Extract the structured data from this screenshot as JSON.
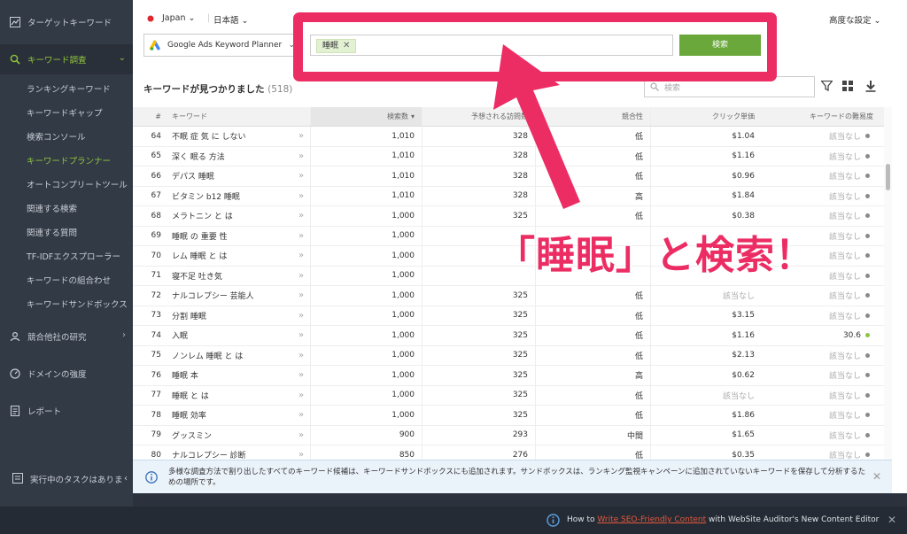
{
  "sidebar": {
    "sections": [
      {
        "label": "ターゲットキーワード",
        "icon": "chart-line-icon"
      },
      {
        "label": "キーワード調査",
        "icon": "search-icon"
      },
      {
        "label": "競合他社の研究",
        "icon": "users-icon"
      },
      {
        "label": "ドメインの強度",
        "icon": "gauge-icon"
      },
      {
        "label": "レポート",
        "icon": "report-icon"
      }
    ],
    "items": [
      "ランキングキーワード",
      "キーワードギャップ",
      "検索コンソール",
      "キーワードプランナー",
      "オートコンプリートツール",
      "関連する検索",
      "関連する質問",
      "TF-IDFエクスプローラー",
      "キーワードの組合わせ",
      "キーワードサンドボックス"
    ],
    "task_label": "実行中のタスクはありま",
    "collapse_glyph": "‹"
  },
  "topbar": {
    "country": "Japan",
    "language": "日本語",
    "advanced": "高度な設定"
  },
  "search": {
    "source": "Google Ads Keyword Planner",
    "tag": "睡眠",
    "button": "検索"
  },
  "results": {
    "title": "キーワードが見つかりました",
    "count": "(518)",
    "filter_placeholder": "検索"
  },
  "table": {
    "headers": {
      "num": "#",
      "keyword": "キーワード",
      "volume": "検索数",
      "visits": "予想される訪問数",
      "competition": "競合性",
      "cpc": "クリック単価",
      "difficulty": "キーワードの難易度"
    },
    "rows": [
      {
        "num": "64",
        "keyword": "不眠 症 気 に しない",
        "volume": "1,010",
        "visits": "328",
        "competition": "低",
        "cpc": "$1.04",
        "difficulty": "該当なし"
      },
      {
        "num": "65",
        "keyword": "深く 眠る 方法",
        "volume": "1,010",
        "visits": "328",
        "competition": "低",
        "cpc": "$1.16",
        "difficulty": "該当なし"
      },
      {
        "num": "66",
        "keyword": "デパス 睡眠",
        "volume": "1,010",
        "visits": "328",
        "competition": "低",
        "cpc": "$0.96",
        "difficulty": "該当なし"
      },
      {
        "num": "67",
        "keyword": "ビタミン b12 睡眠",
        "volume": "1,010",
        "visits": "328",
        "competition": "高",
        "cpc": "$1.84",
        "difficulty": "該当なし"
      },
      {
        "num": "68",
        "keyword": "メラトニン と は",
        "volume": "1,000",
        "visits": "325",
        "competition": "低",
        "cpc": "$0.38",
        "difficulty": "該当なし"
      },
      {
        "num": "69",
        "keyword": "睡眠 の 重要 性",
        "volume": "1,000",
        "visits": "",
        "competition": "",
        "cpc": "",
        "difficulty": "該当なし"
      },
      {
        "num": "70",
        "keyword": "レム 睡眠 と は",
        "volume": "1,000",
        "visits": "",
        "competition": "",
        "cpc": "",
        "difficulty": "該当なし"
      },
      {
        "num": "71",
        "keyword": "寝不足 吐き気",
        "volume": "1,000",
        "visits": "",
        "competition": "",
        "cpc": "",
        "difficulty": "該当なし"
      },
      {
        "num": "72",
        "keyword": "ナルコレプシー 芸能人",
        "volume": "1,000",
        "visits": "325",
        "competition": "低",
        "cpc": "該当なし",
        "difficulty": "該当なし"
      },
      {
        "num": "73",
        "keyword": "分割 睡眠",
        "volume": "1,000",
        "visits": "325",
        "competition": "低",
        "cpc": "$3.15",
        "difficulty": "該当なし"
      },
      {
        "num": "74",
        "keyword": "入眠",
        "volume": "1,000",
        "visits": "325",
        "competition": "低",
        "cpc": "$1.16",
        "difficulty": "30.6"
      },
      {
        "num": "75",
        "keyword": "ノンレム 睡眠 と は",
        "volume": "1,000",
        "visits": "325",
        "competition": "低",
        "cpc": "$2.13",
        "difficulty": "該当なし"
      },
      {
        "num": "76",
        "keyword": "睡眠 本",
        "volume": "1,000",
        "visits": "325",
        "competition": "高",
        "cpc": "$0.62",
        "difficulty": "該当なし"
      },
      {
        "num": "77",
        "keyword": "睡眠 と は",
        "volume": "1,000",
        "visits": "325",
        "competition": "低",
        "cpc": "該当なし",
        "difficulty": "該当なし"
      },
      {
        "num": "78",
        "keyword": "睡眠 効率",
        "volume": "1,000",
        "visits": "325",
        "competition": "低",
        "cpc": "$1.86",
        "difficulty": "該当なし"
      },
      {
        "num": "79",
        "keyword": "グッスミン",
        "volume": "900",
        "visits": "293",
        "competition": "中間",
        "cpc": "$1.65",
        "difficulty": "該当なし"
      },
      {
        "num": "80",
        "keyword": "ナルコレプシー 診断",
        "volume": "850",
        "visits": "276",
        "competition": "低",
        "cpc": "$0.35",
        "difficulty": "該当なし"
      }
    ]
  },
  "info": {
    "text": "多様な調査方法で割り出したすべてのキーワード候補は、キーワードサンドボックスにも追加されます。サンドボックスは、ランキング監視キャンペーンに追加されていないキーワードを保存して分析するための場所です。"
  },
  "bottom": {
    "prefix": "How to ",
    "link": "Write SEO-Friendly Content",
    "suffix": " with WebSite Auditor's New Content Editor"
  },
  "annotation": "「睡眠」と検索！",
  "colors": {
    "accent": "#8fc53f",
    "callout": "#ec2d64",
    "button": "#6aa83b",
    "sidebar": "#323a45"
  }
}
